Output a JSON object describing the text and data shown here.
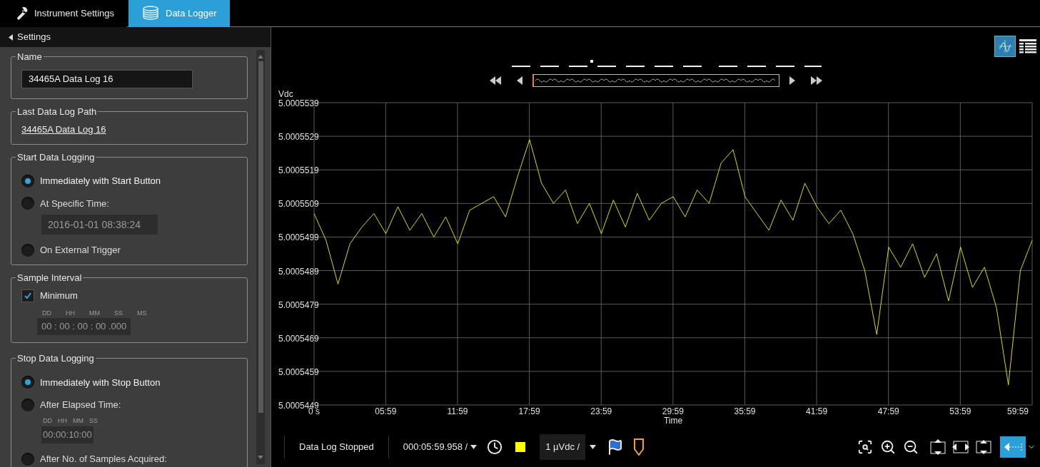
{
  "tabs": [
    {
      "label": "Instrument Settings",
      "kind": "wrench",
      "selected": false
    },
    {
      "label": "Data Logger",
      "kind": "disks",
      "selected": true
    }
  ],
  "settings_panel": {
    "title": "Settings",
    "name_group": {
      "legend": "Name",
      "value": "34465A Data Log 16"
    },
    "path_group": {
      "legend": "Last Data Log Path",
      "link": "34465A Data Log 16"
    },
    "start_group": {
      "legend": "Start Data Logging",
      "options": [
        {
          "label": "Immediately with Start Button",
          "selected": true
        },
        {
          "label": "At Specific Time:",
          "selected": false,
          "date_field": "2016-01-01 08:38:24"
        },
        {
          "label": "On External Trigger",
          "selected": false
        }
      ]
    },
    "interval_group": {
      "legend": "Sample Interval",
      "checkbox": {
        "label": "Minimum",
        "checked": true
      },
      "field_labels": [
        "DD",
        "HH",
        "MM",
        "SS",
        "MS"
      ],
      "value": "00 : 00 : 00 : 00 .000"
    },
    "stop_group": {
      "legend": "Stop Data Logging",
      "options": [
        {
          "label": "Immediately with Stop Button",
          "selected": true
        },
        {
          "label": "After Elapsed Time:",
          "selected": false,
          "timer": {
            "labels": [
              "DD",
              "HH",
              "MM",
              "SS"
            ],
            "value": "00:00:10:00"
          }
        },
        {
          "label": "After No. of Samples Acquired:",
          "selected": false
        }
      ]
    }
  },
  "view_buttons": [
    {
      "kind": "chart",
      "selected": true
    },
    {
      "kind": "table",
      "selected": false
    }
  ],
  "chart": {
    "chart_data": {
      "type": "line",
      "xlabel": "Time",
      "ylabel": "Vdc",
      "x": [
        0,
        60,
        120,
        180,
        240,
        300,
        360,
        420,
        480,
        540,
        600,
        660,
        720,
        780,
        840,
        900,
        960,
        1020,
        1080,
        1140,
        1200,
        1260,
        1320,
        1380,
        1440,
        1500,
        1560,
        1620,
        1680,
        1740,
        1800,
        1860,
        1920,
        1980,
        2040,
        2100,
        2160,
        2220,
        2280,
        2340,
        2400,
        2460,
        2520,
        2580,
        2640,
        2700,
        2760,
        2820,
        2880,
        2940,
        3000,
        3060,
        3120,
        3180,
        3240,
        3300,
        3360,
        3420,
        3480,
        3540,
        3599
      ],
      "grid": true,
      "series": [
        {
          "color": "#ffff00",
          "values": [
            5.0005506,
            5.0005498,
            5.0005485,
            5.0005497,
            5.0005502,
            5.0005506,
            5.00055,
            5.0005508,
            5.0005501,
            5.0005506,
            5.0005499,
            5.0005505,
            5.0005497,
            5.0005507,
            5.0005509,
            5.0005511,
            5.0005505,
            5.0005517,
            5.0005528,
            5.0005515,
            5.0005509,
            5.0005513,
            5.0005503,
            5.0005509,
            5.00055,
            5.000551,
            5.0005502,
            5.0005512,
            5.0005504,
            5.0005509,
            5.0005511,
            5.0005505,
            5.0005513,
            5.0005509,
            5.0005521,
            5.0005525,
            5.0005511,
            5.0005506,
            5.0005501,
            5.000551,
            5.0005504,
            5.0005515,
            5.0005508,
            5.0005503,
            5.0005507,
            5.00055,
            5.0005489,
            5.000547,
            5.0005496,
            5.000549,
            5.0005497,
            5.0005487,
            5.0005494,
            5.000548,
            5.0005496,
            5.0005484,
            5.000549,
            5.0005478,
            5.0005455,
            5.0005489,
            5.0005498
          ]
        }
      ],
      "xlim": [
        0,
        3599
      ],
      "ylim": [
        5.0005449,
        5.0005539
      ],
      "xticks": [
        {
          "value": 0,
          "label": "0 s"
        },
        {
          "value": 359,
          "label": "05:59"
        },
        {
          "value": 719,
          "label": "11:59"
        },
        {
          "value": 1079,
          "label": "17:59"
        },
        {
          "value": 1439,
          "label": "23:59"
        },
        {
          "value": 1799,
          "label": "29:59"
        },
        {
          "value": 2159,
          "label": "35:59"
        },
        {
          "value": 2519,
          "label": "41:59"
        },
        {
          "value": 2879,
          "label": "47:59"
        },
        {
          "value": 3239,
          "label": "53:59"
        },
        {
          "value": 3599,
          "label": "59:59"
        }
      ],
      "yticks": [
        {
          "value": 5.0005449,
          "label": "5.0005449"
        },
        {
          "value": 5.0005459,
          "label": "5.0005459"
        },
        {
          "value": 5.0005469,
          "label": "5.0005469"
        },
        {
          "value": 5.0005479,
          "label": "5.0005479"
        },
        {
          "value": 5.0005489,
          "label": "5.0005489"
        },
        {
          "value": 5.0005499,
          "label": "5.0005499"
        },
        {
          "value": 5.0005509,
          "label": "5.0005509"
        },
        {
          "value": 5.0005519,
          "label": "5.0005519"
        },
        {
          "value": 5.0005529,
          "label": "5.0005529"
        },
        {
          "value": 5.0005539,
          "label": "5.0005539"
        }
      ]
    }
  },
  "toolbar": {
    "status": "Data Log Stopped",
    "time_scale": "000:05:59.958 /",
    "amplitude_scale": "1 µVdc /"
  }
}
